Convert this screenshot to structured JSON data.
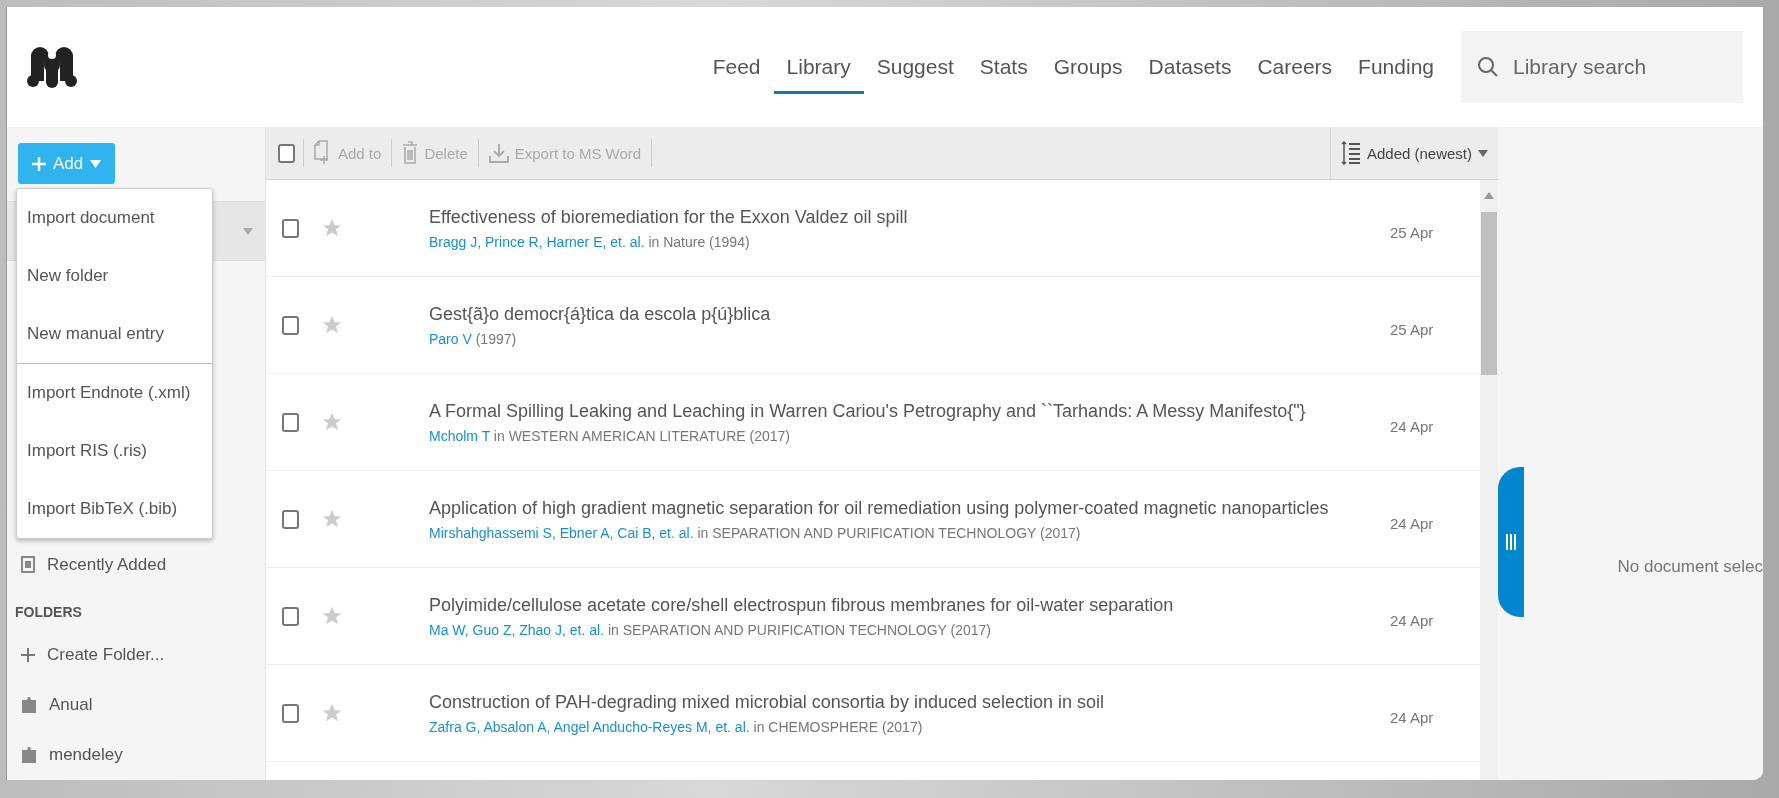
{
  "nav": [
    {
      "label": "Feed",
      "selected": false
    },
    {
      "label": "Library",
      "selected": true
    },
    {
      "label": "Suggest",
      "selected": false
    },
    {
      "label": "Stats",
      "selected": false
    },
    {
      "label": "Groups",
      "selected": false
    },
    {
      "label": "Datasets",
      "selected": false
    },
    {
      "label": "Careers",
      "selected": false
    },
    {
      "label": "Funding",
      "selected": false
    }
  ],
  "search": {
    "placeholder": "Library search"
  },
  "add_button": {
    "label": "Add"
  },
  "add_menu": {
    "groups": [
      [
        "Import document",
        "New folder",
        "New manual entry"
      ],
      [
        "Import Endnote (.xml)",
        "Import RIS (.ris)",
        "Import BibTeX (.bib)"
      ]
    ]
  },
  "sidebar": {
    "recently_added": "Recently Added",
    "folders_heading": "FOLDERS",
    "create_folder": "Create Folder...",
    "folders": [
      "Anual",
      "mendeley"
    ]
  },
  "toolbar": {
    "select_all": {
      "checked": false
    },
    "actions": [
      {
        "kind": "add",
        "label": "Add to",
        "disabled": true
      },
      {
        "kind": "delete",
        "label": "Delete",
        "disabled": true
      },
      {
        "kind": "export",
        "label": "Export to MS Word",
        "disabled": true
      }
    ],
    "sort": "Added (newest)"
  },
  "documents": [
    {
      "title": "Effectiveness of bioremediation for the Exxon Valdez oil spill",
      "authors": "Bragg J, Prince R, Harner E, et. al.",
      "details": "in Nature (1994)",
      "date": "25 Apr",
      "checked": false,
      "starred": false
    },
    {
      "title": "Gest{ã}o democr{á}tica da escola p{ú}blica",
      "authors": "Paro V",
      "details": "(1997)",
      "date": "25 Apr",
      "checked": false,
      "starred": false
    },
    {
      "title": "A Formal Spilling Leaking and Leaching in Warren Cariou's Petrography and ``Tarhands: A Messy Manifesto{\"}",
      "authors": "Mcholm T",
      "details": "in WESTERN AMERICAN LITERATURE (2017)",
      "date": "24 Apr",
      "checked": false,
      "starred": false
    },
    {
      "title": "Application of high gradient magnetic separation for oil remediation using polymer-coated magnetic nanoparticles",
      "authors": "Mirshahghassemi S, Ebner A, Cai B, et. al.",
      "details": "in SEPARATION AND PURIFICATION TECHNOLOGY (2017)",
      "date": "24 Apr",
      "checked": false,
      "starred": false
    },
    {
      "title": "Polyimide/cellulose acetate core/shell electrospun fibrous membranes for oil-water separation",
      "authors": "Ma W, Guo Z, Zhao J, et. al.",
      "details": "in SEPARATION AND PURIFICATION TECHNOLOGY (2017)",
      "date": "24 Apr",
      "checked": false,
      "starred": false
    },
    {
      "title": "Construction of PAH-degrading mixed microbial consortia by induced selection in soil",
      "authors": "Zafra G, Absalon A, Angel Anducho-Reyes M, et. al.",
      "details": "in CHEMOSPHERE (2017)",
      "date": "24 Apr",
      "checked": false,
      "starred": false
    }
  ],
  "detail_panel": {
    "message": "No document selec"
  }
}
